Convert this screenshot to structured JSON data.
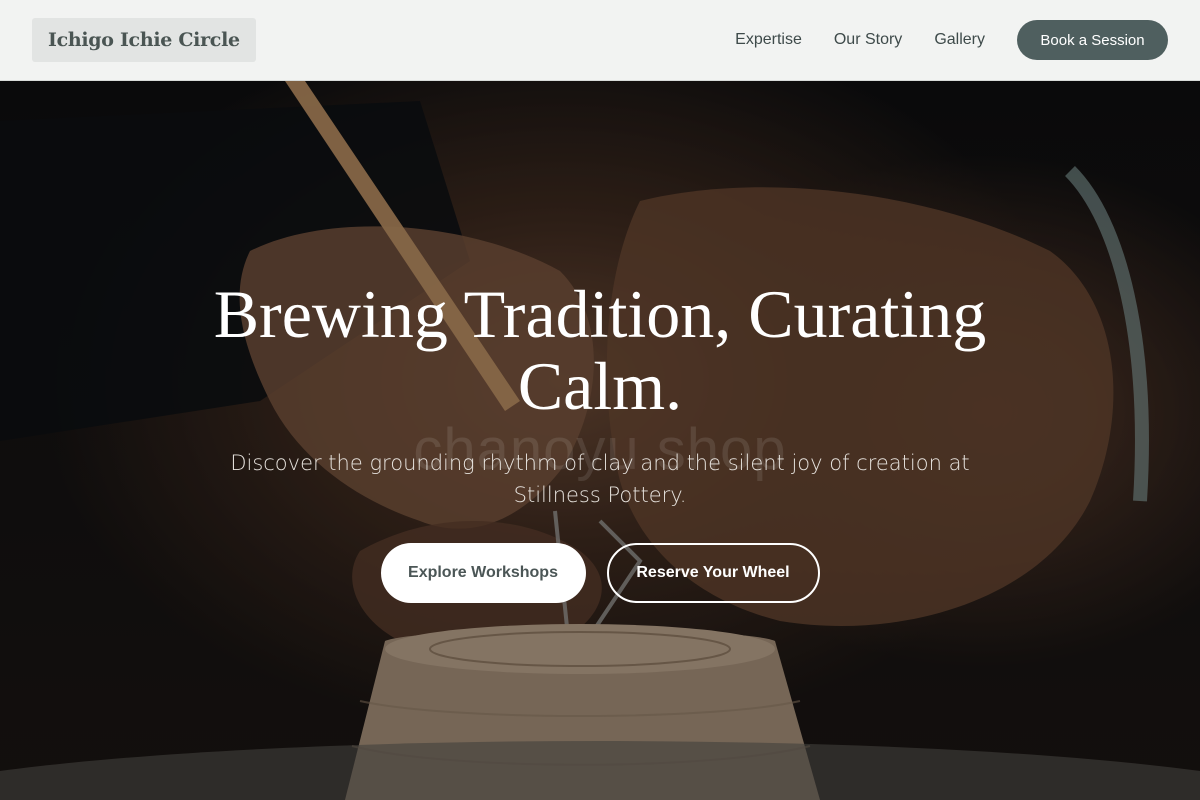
{
  "header": {
    "logo_text": "Ichigo Ichie Circle",
    "nav": [
      {
        "label": "Expertise"
      },
      {
        "label": "Our Story"
      },
      {
        "label": "Gallery"
      }
    ],
    "cta_label": "Book a Session"
  },
  "hero": {
    "title": "Brewing Tradition, Curating Calm.",
    "watermark": "chanoyu shop",
    "subtitle": "Discover the grounding rhythm of clay and the silent joy of creation at Stillness Pottery.",
    "primary_button": "Explore Workshops",
    "secondary_button": "Reserve Your Wheel",
    "image_subject": "hands-carving-clay-pot-photo"
  },
  "colors": {
    "header_bg": "#f2f3f2",
    "accent": "#4f5f5f",
    "nav_text": "#3e4a4a",
    "clay": "#a48e78"
  }
}
